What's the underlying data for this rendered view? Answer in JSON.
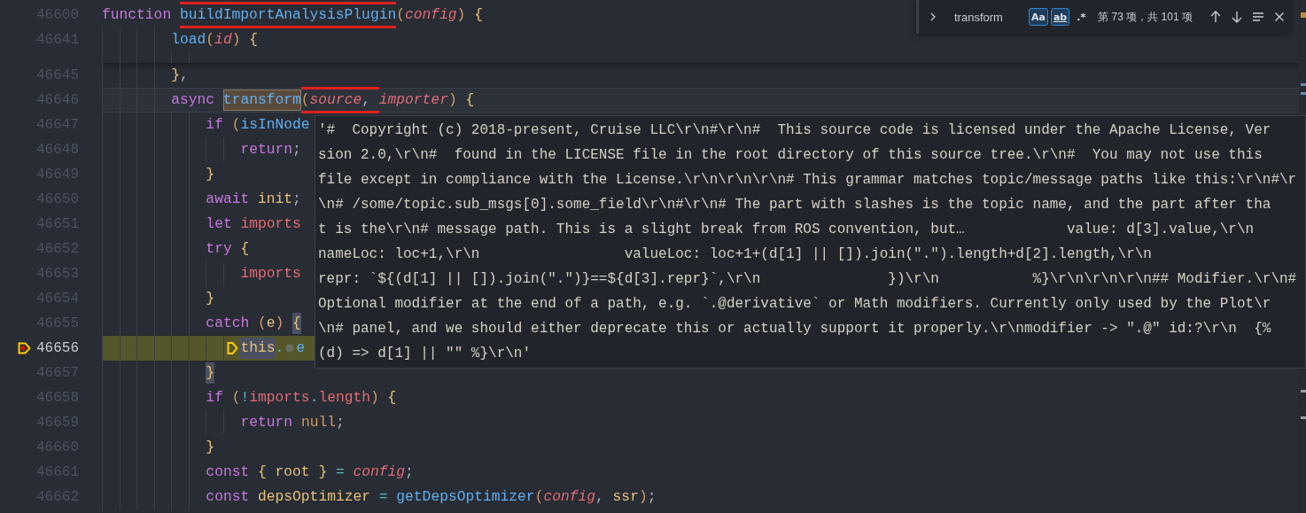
{
  "editor": {
    "lines": [
      {
        "number": "46600",
        "sticky": true,
        "cursor": false,
        "paused": false,
        "tokens": [
          {
            "kind": "keyword",
            "text": "function "
          },
          {
            "kind": "function",
            "text": "buildImportAnalysisPlugin",
            "boxed": true
          },
          {
            "kind": "bracket",
            "text": "("
          },
          {
            "kind": "param",
            "text": "config"
          },
          {
            "kind": "bracket",
            "text": ") "
          },
          {
            "kind": "brace",
            "text": "{"
          }
        ],
        "children": [
          {
            "number": "46641",
            "sticky": true,
            "cursor": false,
            "paused": false,
            "tokens": [
              {
                "kind": "function",
                "text": "load"
              },
              {
                "kind": "bracket",
                "text": "("
              },
              {
                "kind": "param",
                "text": "id"
              },
              {
                "kind": "bracket",
                "text": ") "
              },
              {
                "kind": "brace",
                "text": "{"
              }
            ]
          },
          {
            "number": "46645",
            "sticky": false,
            "cursor": false,
            "paused": false,
            "tokens": [
              {
                "kind": "brace",
                "text": "}"
              },
              {
                "kind": "punct",
                "text": ","
              }
            ]
          },
          {
            "number": "46646",
            "sticky": false,
            "cursor": true,
            "paused": false,
            "tokens": [
              {
                "kind": "keyword",
                "text": "async "
              },
              {
                "kind": "function",
                "text": "transform",
                "match": true
              },
              {
                "kind": "bracket",
                "text": "(",
                "boxed": true
              },
              {
                "kind": "param",
                "text": "source",
                "boxed": true
              },
              {
                "kind": "punct",
                "text": ", ",
                "boxed": true
              },
              {
                "kind": "param",
                "text": "importer"
              },
              {
                "kind": "bracket",
                "text": ") "
              },
              {
                "kind": "brace",
                "text": "{"
              }
            ],
            "children": [
              {
                "number": "46647",
                "sticky": false,
                "cursor": false,
                "paused": false,
                "tokens": [
                  {
                    "kind": "keyword",
                    "text": "if "
                  },
                  {
                    "kind": "bracket",
                    "text": "("
                  },
                  {
                    "kind": "function",
                    "text": "isInNode"
                  }
                ],
                "children": [
                  {
                    "number": "46648",
                    "sticky": false,
                    "cursor": false,
                    "paused": false,
                    "tokens": [
                      {
                        "kind": "keyword",
                        "text": "return"
                      },
                      {
                        "kind": "punct",
                        "text": ";"
                      }
                    ]
                  }
                ]
              },
              {
                "number": "46649",
                "sticky": false,
                "cursor": false,
                "paused": false,
                "tokens": [
                  {
                    "kind": "brace",
                    "text": "}"
                  }
                ]
              },
              {
                "number": "46650",
                "sticky": false,
                "cursor": false,
                "paused": false,
                "tokens": [
                  {
                    "kind": "keyword",
                    "text": "await "
                  },
                  {
                    "kind": "ident",
                    "text": "init"
                  },
                  {
                    "kind": "punct",
                    "text": ";"
                  }
                ]
              },
              {
                "number": "46651",
                "sticky": false,
                "cursor": false,
                "paused": false,
                "tokens": [
                  {
                    "kind": "keyword",
                    "text": "let "
                  },
                  {
                    "kind": "variable",
                    "text": "imports"
                  }
                ]
              },
              {
                "number": "46652",
                "sticky": false,
                "cursor": false,
                "paused": false,
                "tokens": [
                  {
                    "kind": "keyword",
                    "text": "try "
                  },
                  {
                    "kind": "brace",
                    "text": "{"
                  }
                ],
                "children": [
                  {
                    "number": "46653",
                    "sticky": false,
                    "cursor": false,
                    "paused": false,
                    "tokens": [
                      {
                        "kind": "variable",
                        "text": "imports"
                      }
                    ]
                  }
                ]
              },
              {
                "number": "46654",
                "sticky": false,
                "cursor": false,
                "paused": false,
                "tokens": [
                  {
                    "kind": "brace",
                    "text": "}"
                  }
                ]
              },
              {
                "number": "46655",
                "sticky": false,
                "cursor": false,
                "paused": false,
                "tokens": [
                  {
                    "kind": "keyword",
                    "text": "catch "
                  },
                  {
                    "kind": "bracket",
                    "text": "("
                  },
                  {
                    "kind": "ident",
                    "text": "e"
                  },
                  {
                    "kind": "bracket",
                    "text": ") "
                  },
                  {
                    "kind": "brace",
                    "text": "{",
                    "word": true
                  }
                ],
                "children": [
                  {
                    "number": "46656",
                    "sticky": false,
                    "cursor": false,
                    "paused": true,
                    "tokens": [
                      {
                        "kind": "ident",
                        "text": "this",
                        "word": true
                      },
                      {
                        "kind": "operator",
                        "text": "."
                      },
                      {
                        "kind": "function",
                        "text": "e"
                      }
                    ]
                  }
                ]
              },
              {
                "number": "46657",
                "sticky": false,
                "cursor": false,
                "paused": false,
                "tokens": [
                  {
                    "kind": "brace",
                    "text": "}",
                    "word": true
                  }
                ]
              },
              {
                "number": "46658",
                "sticky": false,
                "cursor": false,
                "paused": false,
                "tokens": [
                  {
                    "kind": "keyword",
                    "text": "if "
                  },
                  {
                    "kind": "bracket",
                    "text": "("
                  },
                  {
                    "kind": "operator",
                    "text": "!"
                  },
                  {
                    "kind": "variable",
                    "text": "imports"
                  },
                  {
                    "kind": "operator",
                    "text": "."
                  },
                  {
                    "kind": "variable",
                    "text": "length"
                  },
                  {
                    "kind": "bracket",
                    "text": ") "
                  },
                  {
                    "kind": "brace",
                    "text": "{"
                  }
                ],
                "children": [
                  {
                    "number": "46659",
                    "sticky": false,
                    "cursor": false,
                    "paused": false,
                    "tokens": [
                      {
                        "kind": "keyword",
                        "text": "return "
                      },
                      {
                        "kind": "constant",
                        "text": "null"
                      },
                      {
                        "kind": "punct",
                        "text": ";"
                      }
                    ]
                  }
                ]
              },
              {
                "number": "46660",
                "sticky": false,
                "cursor": false,
                "paused": false,
                "tokens": [
                  {
                    "kind": "brace",
                    "text": "}"
                  }
                ]
              },
              {
                "number": "46661",
                "sticky": false,
                "cursor": false,
                "paused": false,
                "tokens": [
                  {
                    "kind": "keyword",
                    "text": "const "
                  },
                  {
                    "kind": "brace",
                    "text": "{ "
                  },
                  {
                    "kind": "ident",
                    "text": "root"
                  },
                  {
                    "kind": "brace",
                    "text": " }"
                  },
                  {
                    "kind": "operator",
                    "text": " = "
                  },
                  {
                    "kind": "param",
                    "text": "config"
                  },
                  {
                    "kind": "punct",
                    "text": ";"
                  }
                ]
              },
              {
                "number": "46662",
                "sticky": false,
                "cursor": false,
                "paused": false,
                "tokens": [
                  {
                    "kind": "keyword",
                    "text": "const "
                  },
                  {
                    "kind": "ident",
                    "text": "depsOptimizer"
                  },
                  {
                    "kind": "operator",
                    "text": " = "
                  },
                  {
                    "kind": "function",
                    "text": "getDepsOptimizer"
                  },
                  {
                    "kind": "bracket",
                    "text": "("
                  },
                  {
                    "kind": "param",
                    "text": "config"
                  },
                  {
                    "kind": "punct",
                    "text": ", "
                  },
                  {
                    "kind": "ident",
                    "text": "ssr"
                  },
                  {
                    "kind": "bracket",
                    "text": ")"
                  },
                  {
                    "kind": "punct",
                    "text": ";"
                  }
                ]
              }
            ]
          }
        ]
      }
    ]
  },
  "find_widget": {
    "value": "transform",
    "options": [
      {
        "label": "Aa",
        "on": true
      },
      {
        "label": "ab",
        "on": true
      },
      {
        "label": ".*",
        "on": false
      }
    ],
    "count": "第 73 项，共 101 项"
  },
  "hover": {
    "lines": [
      "'#  Copyright (c) 2018-present, Cruise LLC\\r\\n#\\r\\n#  This source code is licensed under the Apache License, Ver",
      "sion 2.0,\\r\\n#  found in the LICENSE file in the root directory of this source tree.\\r\\n#  You may not use this",
      "file except in compliance with the License.\\r\\n\\r\\n\\r\\n# This grammar matches topic/message paths like this:\\r\\n#\\r",
      "\\n# /some/topic.sub_msgs[0].some_field\\r\\n#\\r\\n# The part with slashes is the topic name, and the part after tha",
      "t is the\\r\\n# message path. This is a slight break from ROS convention, but…            value: d[3].value,\\r\\n",
      "nameLoc: loc+1,\\r\\n                 valueLoc: loc+1+(d[1] || []).join(\".\").length+d[2].length,\\r\\n",
      "repr: `${(d[1] || []).join(\".\")}==${d[3].repr}`,\\r\\n               })\\r\\n           %}\\r\\n\\r\\n\\r\\n## Modifier.\\r\\n#",
      "Optional modifier at the end of a path, e.g. `.@derivative` or Math modifiers. Currently only used by the Plot\\r",
      "\\n# panel, and we should either deprecate this or actually support it properly.\\r\\nmodifier -> \".@\" id:?\\r\\n  {%",
      "(d) => d[1] || \"\" %}\\r\\n'"
    ]
  }
}
